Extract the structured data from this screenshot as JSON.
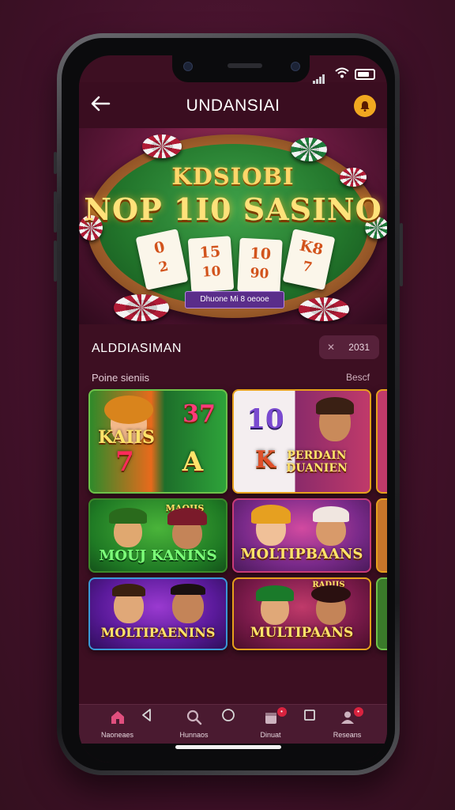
{
  "header": {
    "title": "UNDANSIAI"
  },
  "hero": {
    "line1": "KDSIOBI",
    "line2": "NOP 1I0 SASINO",
    "cards": [
      {
        "top": "0",
        "bottom": "2"
      },
      {
        "top": "15",
        "bottom": "10"
      },
      {
        "top": "10",
        "bottom": "90"
      },
      {
        "top": "K8",
        "bottom": "7"
      }
    ],
    "badge": "Dhuone Mi 8 oeooe"
  },
  "section": {
    "title": "ALDDIASIMAN",
    "sort_value": "2031",
    "subtitle": "Poine sieniis",
    "see_all": "Bescf"
  },
  "games": [
    {
      "label": "KAIIS",
      "num1": "37",
      "num2": "7",
      "num3": "A"
    },
    {
      "label": "PERDAIN DUANIEN",
      "num1": "10",
      "num2": "K"
    },
    {
      "label": "MOUJ KANINS",
      "tag": "MAOIIS"
    },
    {
      "label": "MOLTIPBAANS"
    },
    {
      "label": "MOLTIPAENINS"
    },
    {
      "label": "MULTIPAANS",
      "tag": "RADIIS"
    }
  ],
  "bottom_nav": [
    {
      "label": "Naoneaes",
      "icon": "home-icon",
      "badge": ""
    },
    {
      "label": "Hunnaos",
      "icon": "search-icon",
      "badge": ""
    },
    {
      "label": "Dinuat",
      "icon": "calendar-icon",
      "badge": "•"
    },
    {
      "label": "Reseans",
      "icon": "profile-icon",
      "badge": "•"
    }
  ],
  "colors": {
    "background": "#4a1530",
    "header": "#3a0d20",
    "accent_gold": "#ffd76a",
    "bell": "#f0a820",
    "nav_active": "#e04f7e"
  }
}
